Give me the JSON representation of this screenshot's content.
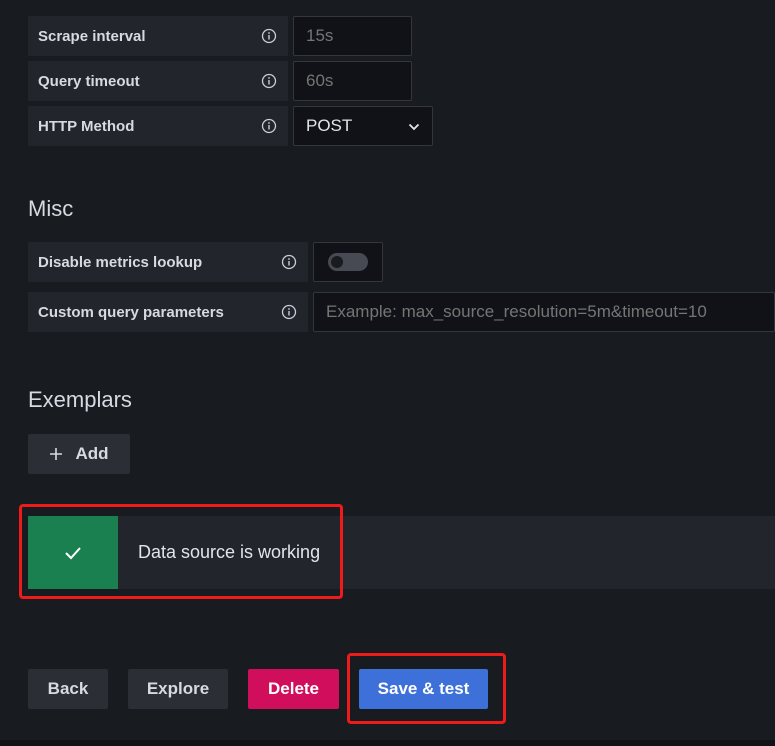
{
  "query_settings": {
    "scrape_interval": {
      "label": "Scrape interval",
      "placeholder": "15s",
      "value": ""
    },
    "query_timeout": {
      "label": "Query timeout",
      "placeholder": "60s",
      "value": ""
    },
    "http_method": {
      "label": "HTTP Method",
      "value": "POST"
    }
  },
  "misc": {
    "title": "Misc",
    "disable_metrics_lookup": {
      "label": "Disable metrics lookup",
      "enabled": false
    },
    "custom_query_parameters": {
      "label": "Custom query parameters",
      "placeholder": "Example: max_source_resolution=5m&timeout=10",
      "value": ""
    }
  },
  "exemplars": {
    "title": "Exemplars",
    "add_label": "Add"
  },
  "alert": {
    "message": "Data source is working",
    "status": "success",
    "color": "#1b8050"
  },
  "actions": {
    "back": "Back",
    "explore": "Explore",
    "delete": "Delete",
    "save_test": "Save & test"
  },
  "icons": {
    "info": "info-circle-icon",
    "chevron": "chevron-down-icon",
    "plus": "plus-icon",
    "check": "check-icon"
  },
  "colors": {
    "primary": "#3d71d9",
    "danger": "#d10e5c",
    "success": "#1b8050",
    "highlight": "#ee1b1b"
  }
}
